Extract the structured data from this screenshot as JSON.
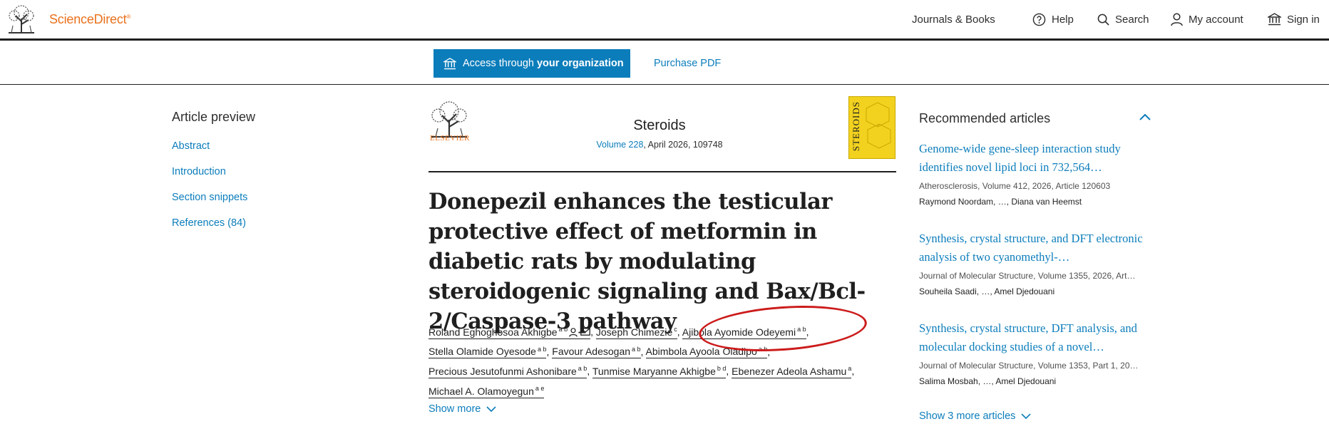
{
  "header": {
    "brand": "ScienceDirect",
    "brand_mark": "®",
    "nav": {
      "journals": "Journals & Books",
      "help": "Help",
      "search": "Search",
      "account": "My account",
      "signin": "Sign in"
    }
  },
  "access": {
    "button_prefix": "Access through",
    "button_bold": "your organization",
    "purchase": "Purchase PDF"
  },
  "preview": {
    "title": "Article preview",
    "items": [
      {
        "label": "Abstract"
      },
      {
        "label": "Introduction"
      },
      {
        "label": "Section snippets"
      },
      {
        "label": "References (84)"
      }
    ]
  },
  "journal": {
    "publisher": "ELSEVIER",
    "name": "Steroids",
    "volume_link": "Volume 228",
    "volume_rest": ", April 2026, 109748",
    "cover_text": "STEROIDS"
  },
  "article": {
    "title": "Donepezil enhances the testicular protective effect of metformin in diabetic rats by modulating steroidogenic signaling and Bax/Bcl-2/Caspase-3 pathway",
    "authors": [
      {
        "name": "Roland Eghoghosoa Akhigbe",
        "sup": "a b"
      },
      {
        "name": "Joseph Chimezie",
        "sup": "c"
      },
      {
        "name": "Ajibola Ayomide Odeyemi",
        "sup": "a b"
      },
      {
        "name": "Stella Olamide Oyesode",
        "sup": "a b"
      },
      {
        "name": "Favour Adesogan",
        "sup": "a b"
      },
      {
        "name": "Abimbola Ayoola Oladipo",
        "sup": "a b"
      },
      {
        "name": "Precious Jesutofunmi Ashonibare",
        "sup": "a b"
      },
      {
        "name": "Tunmise Maryanne Akhigbe",
        "sup": "b d"
      },
      {
        "name": "Ebenezer Adeola Ashamu",
        "sup": "a"
      },
      {
        "name": "Michael A. Olamoyegun",
        "sup": "a e"
      }
    ],
    "show_more": "Show more"
  },
  "recommended": {
    "title": "Recommended articles",
    "items": [
      {
        "title": "Genome-wide gene-sleep interaction study identifies novel lipid loci in 732,564…",
        "meta": "Atherosclerosis, Volume 412, 2026, Article 120603",
        "authors": "Raymond Noordam, …, Diana van Heemst"
      },
      {
        "title": "Synthesis, crystal structure, and DFT electronic analysis of two cyanomethyl-…",
        "meta": "Journal of Molecular Structure, Volume 1355, 2026, Art…",
        "authors": "Souheila Saadi, …, Amel Djedouani"
      },
      {
        "title": "Synthesis, crystal structure, DFT analysis, and molecular docking studies of a novel…",
        "meta": "Journal of Molecular Structure, Volume 1353, Part 1, 20…",
        "authors": "Salima Mosbah, …, Amel Djedouani"
      }
    ],
    "show_more": "Show 3 more articles"
  },
  "colors": {
    "brand_orange": "#e9711c",
    "link_blue": "#0c7dbb",
    "annotation_red": "#cc1b1b",
    "cover_yellow": "#f2d21f"
  }
}
